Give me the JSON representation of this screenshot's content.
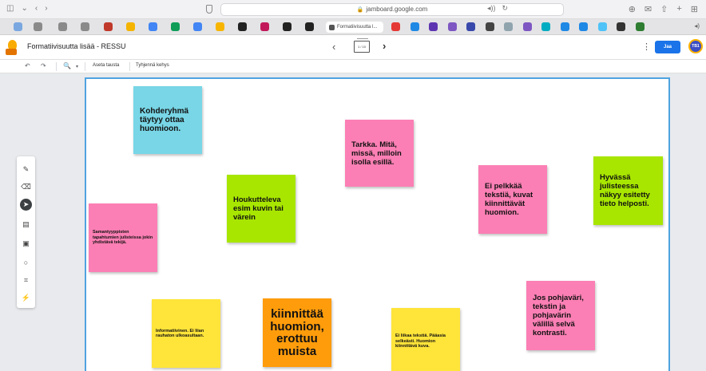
{
  "browser": {
    "address": "jamboard.google.com",
    "active_tab": "Formatiivisuutta l..."
  },
  "header": {
    "title": "Formatiivisuutta lisää - RESSU",
    "frame_counter": "1 / 10",
    "share_label": "Jaa",
    "avatar_initials": "TB1"
  },
  "toolbar": {
    "set_background": "Aseta tausta",
    "clear_frame": "Tyhjennä kehys"
  },
  "tools": [
    "pen-icon",
    "eraser-icon",
    "select-icon",
    "sticky-note-icon",
    "image-icon",
    "shape-icon",
    "text-box-icon",
    "laser-icon"
  ],
  "notes": [
    {
      "text": "Kohderyhmä täytyy ottaa huomioon.",
      "color": "#78d6e6"
    },
    {
      "text": "Tarkka. Mitä, missä, milloin isolla esillä.",
      "color": "#fb7fb4"
    },
    {
      "text": "Ei pelkkää tekstiä, kuvat kiinnittävät huomion.",
      "color": "#fb7fb4"
    },
    {
      "text": "Hyvässä julisteessa näkyy esitetty tieto helposti.",
      "color": "#a8e600"
    },
    {
      "text": "Houkutteleva esim kuvin tai värein",
      "color": "#a8e600"
    },
    {
      "text": "Samantyyppisten tapahtumien julisteissa jokin yhdistävä tekijä.",
      "color": "#fb7fb4"
    },
    {
      "text": "Informatiivinen. Ei liian rauhaton ulkoasultaan.",
      "color": "#ffe43a"
    },
    {
      "text": "kiinnittää huomion, erottuu muista",
      "color": "#ff9c0b"
    },
    {
      "text": "Ei liikaa tekstiä. Pääasia selkeästi. Huomion kiinnittävä kuva.",
      "color": "#ffe43a"
    },
    {
      "text": "Jos pohjaväri, tekstin ja pohjavärin välillä selvä kontrasti.",
      "color": "#fb7fb4"
    }
  ]
}
